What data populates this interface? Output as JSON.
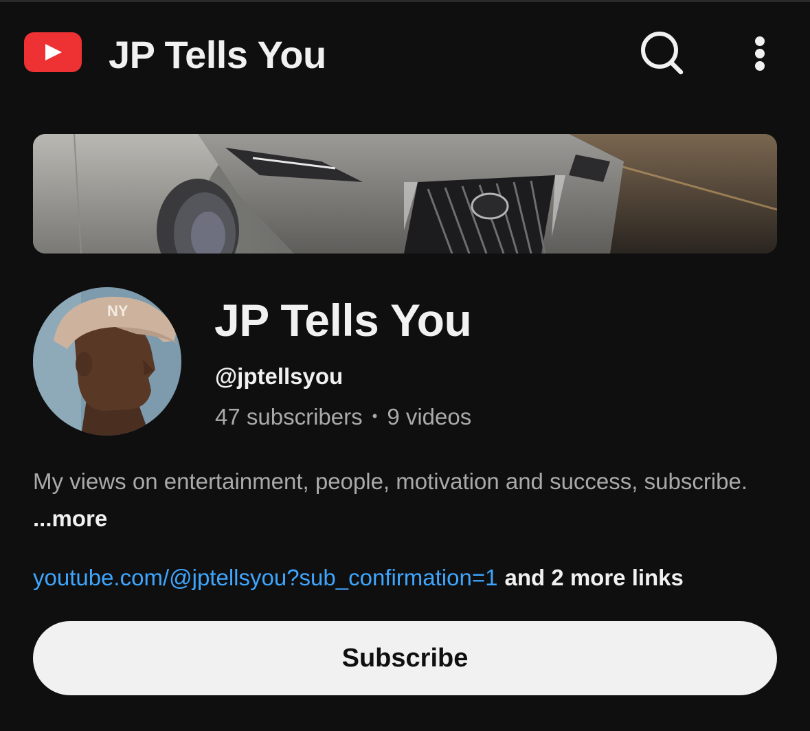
{
  "colors": {
    "background": "#0f0f0f",
    "text_primary": "#f1f1f1",
    "text_secondary": "#aaaaaa",
    "link": "#3ea6ff",
    "youtube_red": "#ee3233",
    "button_bg": "#f1f1f1"
  },
  "header": {
    "logo_icon": "youtube-logo-icon",
    "title": "JP Tells You",
    "search_icon": "search-icon",
    "more_icon": "more-vertical-icon"
  },
  "channel": {
    "name": "JP Tells You",
    "handle": "@jptellsyou",
    "subscribers": "47 subscribers",
    "separator": "•",
    "videos": "9 videos",
    "description": "My views on entertainment, people, motivation and success, subscribe.",
    "more_label": "...more",
    "link_url": "youtube.com/@jptellsyou?sub_confirmation=1",
    "more_links": "and 2 more links",
    "subscribe_label": "Subscribe"
  }
}
